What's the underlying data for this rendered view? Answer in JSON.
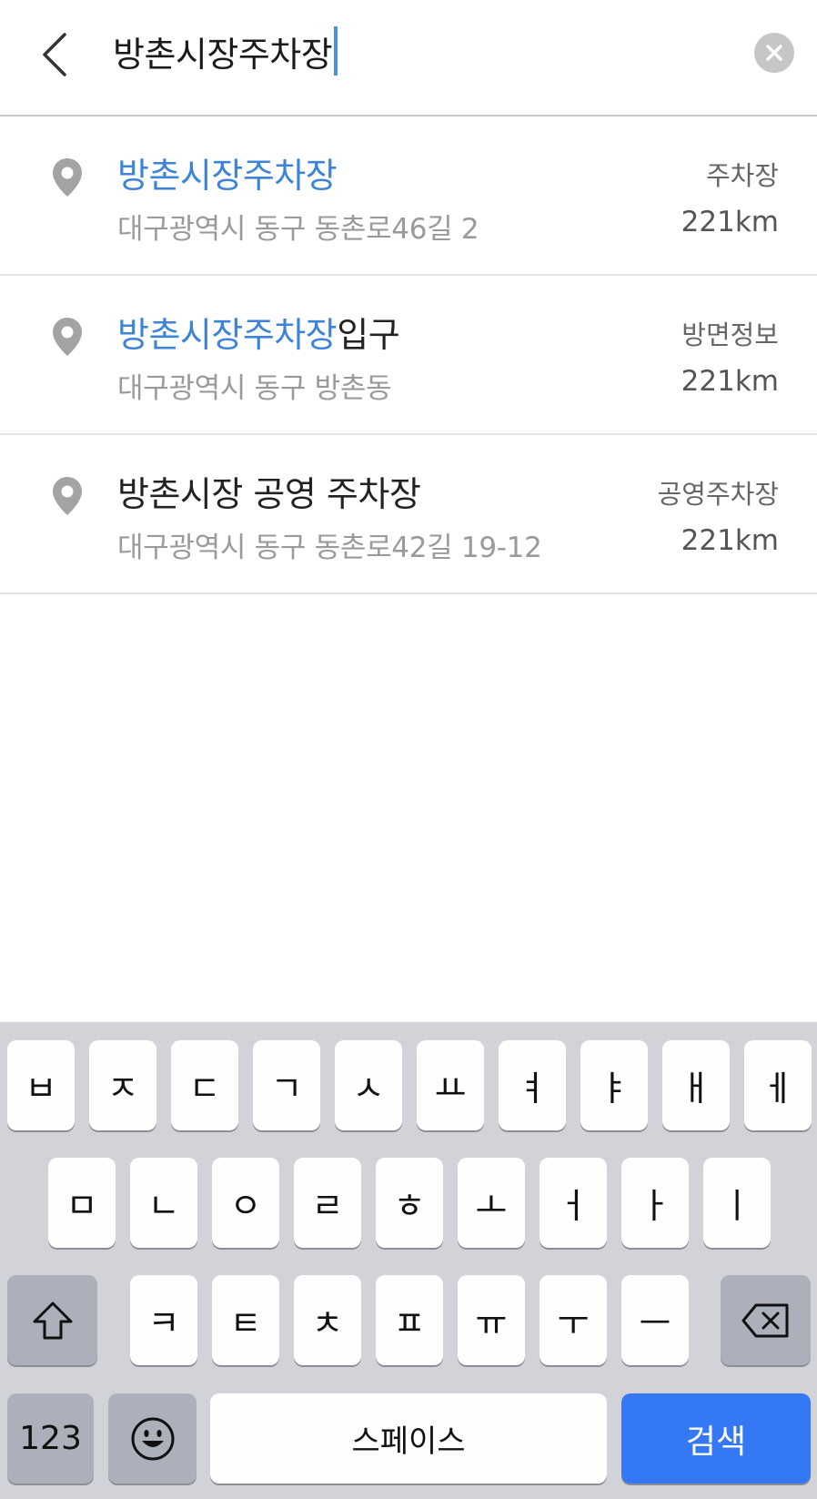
{
  "search": {
    "query": "방촌시장주차장"
  },
  "results": [
    {
      "title_highlight": "방촌시장주차장",
      "title_rest": "",
      "address": "대구광역시 동구 동촌로46길 2",
      "category": "주차장",
      "distance": "221km"
    },
    {
      "title_highlight": "방촌시장주차장",
      "title_rest": "입구",
      "address": "대구광역시 동구 방촌동",
      "category": "방면정보",
      "distance": "221km"
    },
    {
      "title_highlight": "",
      "title_rest": "방촌시장 공영 주차장",
      "address": "대구광역시 동구 동촌로42길 19-12",
      "category": "공영주차장",
      "distance": "221km"
    }
  ],
  "keyboard": {
    "row1": [
      "ㅂ",
      "ㅈ",
      "ㄷ",
      "ㄱ",
      "ㅅ",
      "ㅛ",
      "ㅕ",
      "ㅑ",
      "ㅐ",
      "ㅔ"
    ],
    "row2": [
      "ㅁ",
      "ㄴ",
      "ㅇ",
      "ㄹ",
      "ㅎ",
      "ㅗ",
      "ㅓ",
      "ㅏ",
      "ㅣ"
    ],
    "row3": [
      "ㅋ",
      "ㅌ",
      "ㅊ",
      "ㅍ",
      "ㅠ",
      "ㅜ",
      "ㅡ"
    ],
    "numbers_label": "123",
    "space_label": "스페이스",
    "search_label": "검색"
  },
  "colors": {
    "highlight": "#3d84d9",
    "search_key": "#3478f6",
    "keyboard_bg": "#d1d3d9"
  },
  "icons": {
    "back": "chevron-left-icon",
    "clear": "close-circle-icon",
    "result": "map-pin-icon",
    "shift": "shift-icon",
    "backspace": "backspace-icon",
    "emoji": "emoji-icon"
  }
}
